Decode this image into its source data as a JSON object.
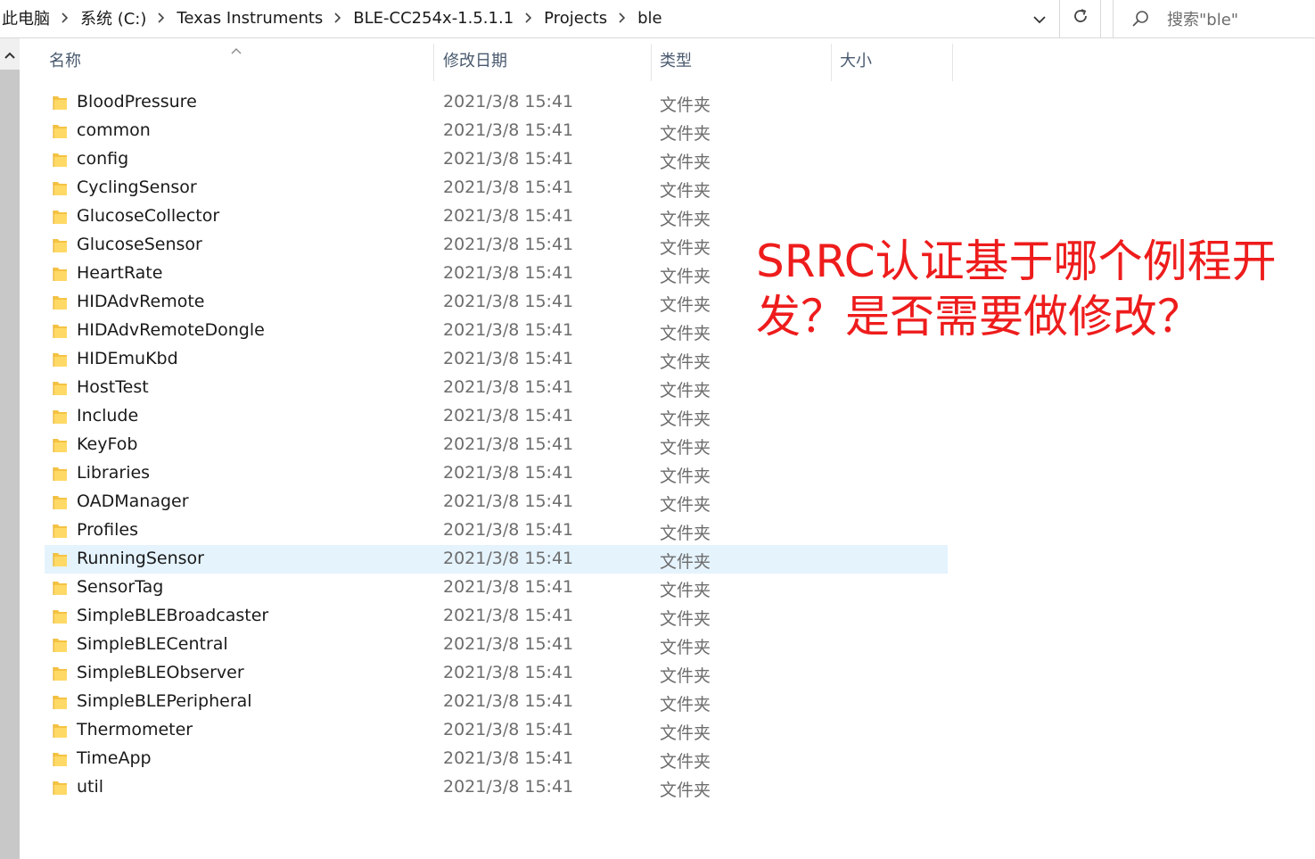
{
  "breadcrumb": {
    "items": [
      "此电脑",
      "系统 (C:)",
      "Texas Instruments",
      "BLE-CC254x-1.5.1.1",
      "Projects",
      "ble"
    ]
  },
  "search": {
    "placeholder": "搜索\"ble\""
  },
  "columns": {
    "name": "名称",
    "date": "修改日期",
    "type": "类型",
    "size": "大小"
  },
  "files": [
    {
      "name": "BloodPressure",
      "date": "2021/3/8 15:41",
      "type": "文件夹"
    },
    {
      "name": "common",
      "date": "2021/3/8 15:41",
      "type": "文件夹"
    },
    {
      "name": "config",
      "date": "2021/3/8 15:41",
      "type": "文件夹"
    },
    {
      "name": "CyclingSensor",
      "date": "2021/3/8 15:41",
      "type": "文件夹"
    },
    {
      "name": "GlucoseCollector",
      "date": "2021/3/8 15:41",
      "type": "文件夹"
    },
    {
      "name": "GlucoseSensor",
      "date": "2021/3/8 15:41",
      "type": "文件夹"
    },
    {
      "name": "HeartRate",
      "date": "2021/3/8 15:41",
      "type": "文件夹"
    },
    {
      "name": "HIDAdvRemote",
      "date": "2021/3/8 15:41",
      "type": "文件夹"
    },
    {
      "name": "HIDAdvRemoteDongle",
      "date": "2021/3/8 15:41",
      "type": "文件夹"
    },
    {
      "name": "HIDEmuKbd",
      "date": "2021/3/8 15:41",
      "type": "文件夹"
    },
    {
      "name": "HostTest",
      "date": "2021/3/8 15:41",
      "type": "文件夹"
    },
    {
      "name": "Include",
      "date": "2021/3/8 15:41",
      "type": "文件夹"
    },
    {
      "name": "KeyFob",
      "date": "2021/3/8 15:41",
      "type": "文件夹"
    },
    {
      "name": "Libraries",
      "date": "2021/3/8 15:41",
      "type": "文件夹"
    },
    {
      "name": "OADManager",
      "date": "2021/3/8 15:41",
      "type": "文件夹"
    },
    {
      "name": "Profiles",
      "date": "2021/3/8 15:41",
      "type": "文件夹"
    },
    {
      "name": "RunningSensor",
      "date": "2021/3/8 15:41",
      "type": "文件夹",
      "selected": true
    },
    {
      "name": "SensorTag",
      "date": "2021/3/8 15:41",
      "type": "文件夹"
    },
    {
      "name": "SimpleBLEBroadcaster",
      "date": "2021/3/8 15:41",
      "type": "文件夹"
    },
    {
      "name": "SimpleBLECentral",
      "date": "2021/3/8 15:41",
      "type": "文件夹"
    },
    {
      "name": "SimpleBLEObserver",
      "date": "2021/3/8 15:41",
      "type": "文件夹"
    },
    {
      "name": "SimpleBLEPeripheral",
      "date": "2021/3/8 15:41",
      "type": "文件夹"
    },
    {
      "name": "Thermometer",
      "date": "2021/3/8 15:41",
      "type": "文件夹"
    },
    {
      "name": "TimeApp",
      "date": "2021/3/8 15:41",
      "type": "文件夹"
    },
    {
      "name": "util",
      "date": "2021/3/8 15:41",
      "type": "文件夹"
    }
  ],
  "annotation": {
    "line1": "SRRC认证基于哪个例程开",
    "line2": "发？是否需要做修改？"
  },
  "colors": {
    "annotation": "#ee1c1c",
    "selected_row": "#e5f3fd",
    "folder": "#f5c343"
  },
  "icons": {
    "folder": "folder-icon",
    "dropdown": "chevron-down-icon",
    "refresh": "refresh-icon",
    "search": "search-icon",
    "breadcrumb_separator": "chevron-right-icon",
    "scroll_up": "chevron-up-icon",
    "sort": "sort-ascending-icon"
  }
}
